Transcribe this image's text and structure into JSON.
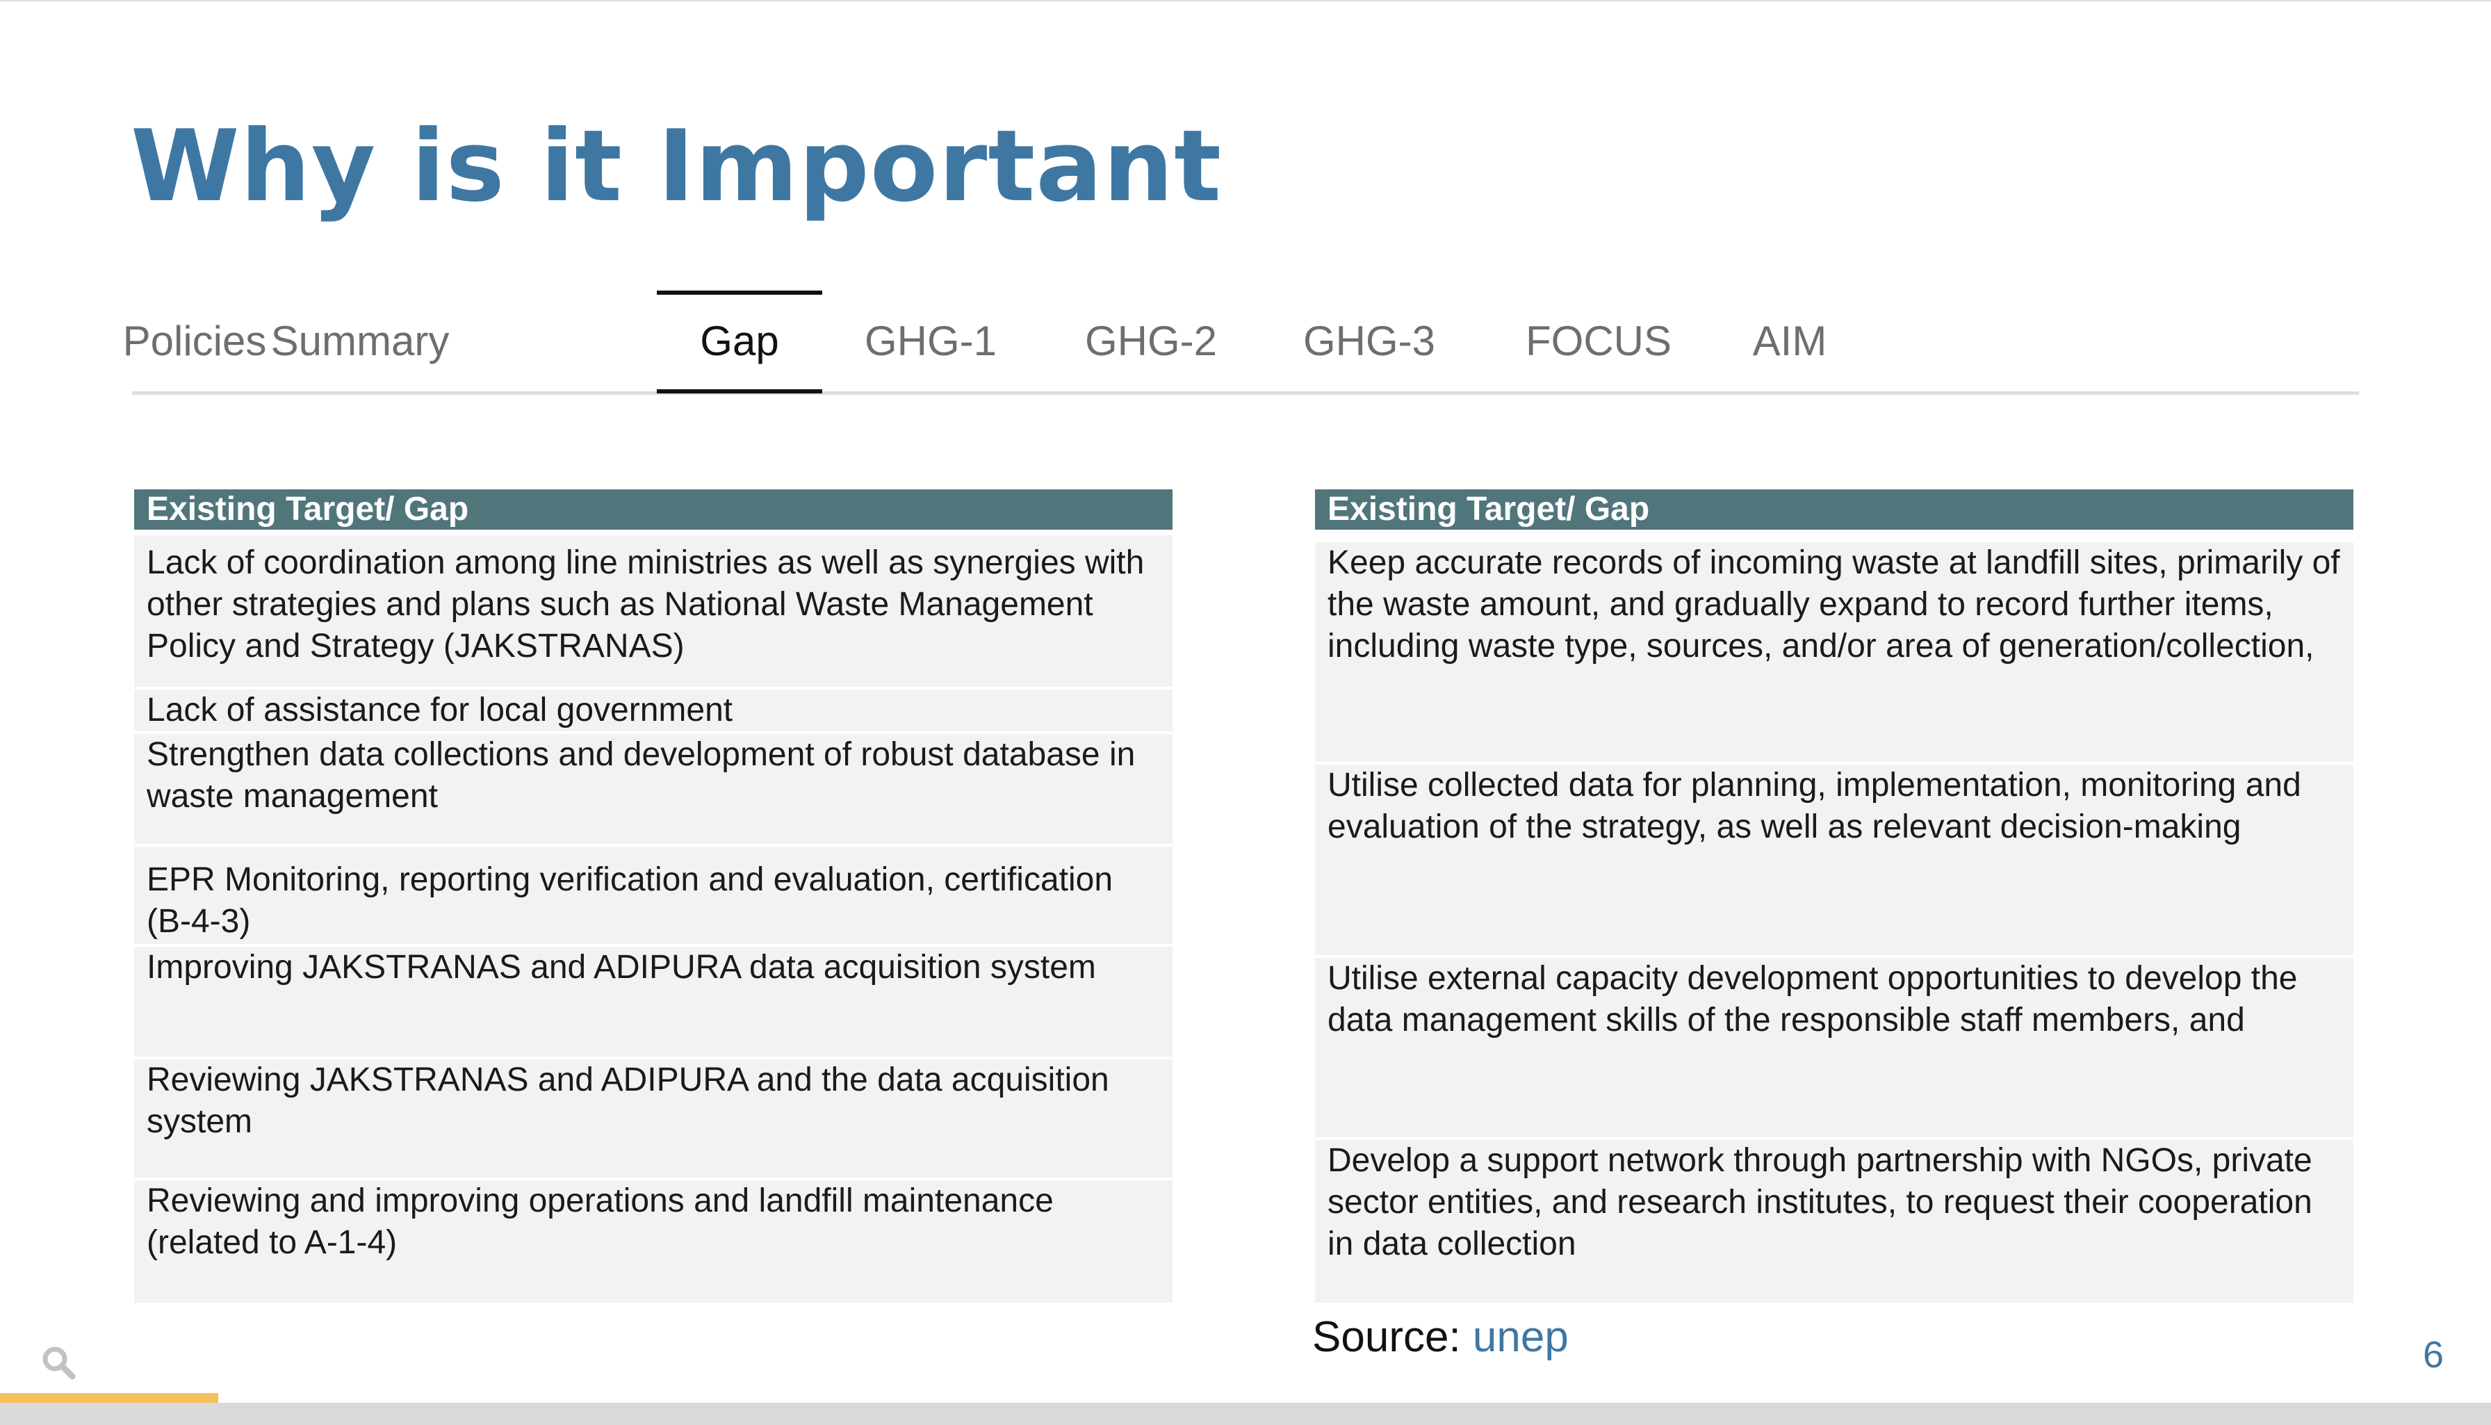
{
  "slide": {
    "title": "Why is it Important",
    "page_number": "6"
  },
  "tabs": [
    {
      "label": "Policies",
      "active": false
    },
    {
      "label": "Summary",
      "active": false
    },
    {
      "label": "Gap",
      "active": true
    },
    {
      "label": "GHG-1",
      "active": false
    },
    {
      "label": "GHG-2",
      "active": false
    },
    {
      "label": "GHG-3",
      "active": false
    },
    {
      "label": "FOCUS",
      "active": false
    },
    {
      "label": "AIM",
      "active": false
    }
  ],
  "left_table": {
    "header": "Existing Target/ Gap",
    "rows": [
      "Lack of coordination among line ministries as well as synergies with other strategies and plans such as National Waste Management Policy and Strategy (JAKSTRANAS)",
      "Lack of assistance for local government",
      "Strengthen data collections and development of robust database in waste management",
      "EPR Monitoring, reporting verification and evaluation, certification (B-4-3)",
      "Improving JAKSTRANAS and ADIPURA data acquisition system",
      "Reviewing JAKSTRANAS and ADIPURA and the data acquisition system",
      "Reviewing and improving operations and landfill maintenance (related to A-1-4)"
    ]
  },
  "right_table": {
    "header": "Existing Target/ Gap",
    "rows": [
      "Keep accurate records of incoming waste at landfill sites, primarily of the waste amount, and gradually expand to record further items, including waste type, sources, and/or area of generation/collection,",
      "Utilise collected data for planning, implementation, monitoring and evaluation of the strategy, as well as relevant decision-making",
      "Utilise external capacity development opportunities to develop the data management skills of the responsible staff members, and",
      "Develop a support network through partnership with NGOs, private sector entities, and research institutes, to request their cooperation in data collection"
    ]
  },
  "source": {
    "label": "Source:",
    "link_text": "unep"
  },
  "progress": {
    "fraction": 0.0875,
    "color": "#f5c15a"
  },
  "colors": {
    "accent": "#3f77a3",
    "table_header": "#50767c",
    "row_fill": "#f2f2f2"
  },
  "icons": {
    "search": "search-icon"
  }
}
